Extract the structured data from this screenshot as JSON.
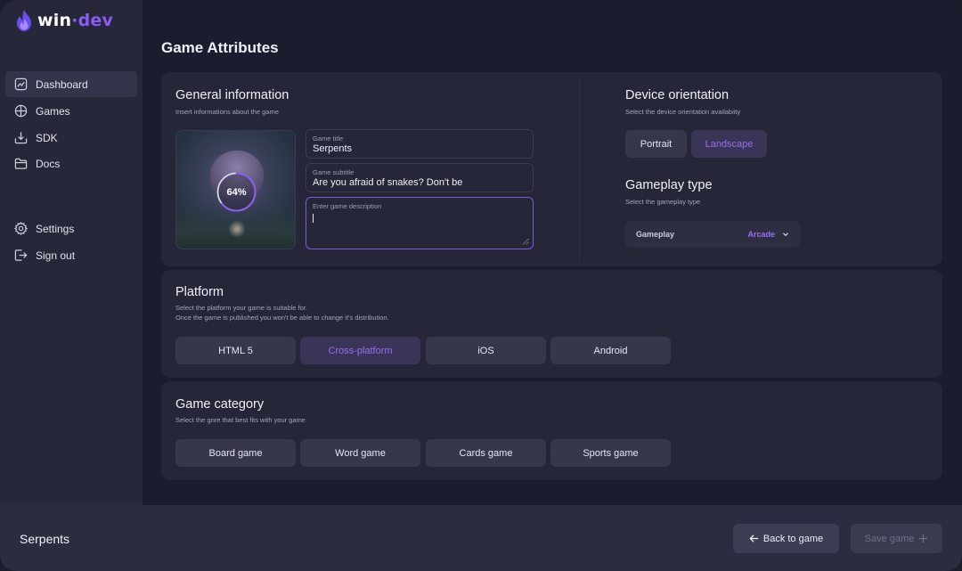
{
  "brand": {
    "name_left": "win",
    "separator": "·",
    "name_right": "dev",
    "accent": "#8a5cf6"
  },
  "sidebar": {
    "items": [
      {
        "label": "Dashboard",
        "icon": "chart-icon",
        "active": true
      },
      {
        "label": "Games",
        "icon": "games-icon"
      },
      {
        "label": "SDK",
        "icon": "download-icon"
      },
      {
        "label": "Docs",
        "icon": "folder-icon"
      },
      {
        "label": "Settings",
        "icon": "gear-icon"
      },
      {
        "label": "Sign out",
        "icon": "sign-out-icon"
      }
    ]
  },
  "page": {
    "title": "Game Attributes"
  },
  "general": {
    "title": "General information",
    "subtitle": "Insert informations about the game",
    "upload_progress": "64%",
    "upload_progress_value": 0.64,
    "fields": {
      "title": {
        "label": "Game title",
        "value": "Serpents"
      },
      "subtitle": {
        "label": "Game subtitle",
        "value": "Are you afraid of snakes? Don't be"
      },
      "description": {
        "label": "Enter game description",
        "value": ""
      }
    }
  },
  "orientation": {
    "title": "Device orientation",
    "subtitle": "Select the device orientation availabiity",
    "options": [
      {
        "label": "Portrait",
        "selected": false
      },
      {
        "label": "Landscape",
        "selected": true
      }
    ]
  },
  "gameplay": {
    "title": "Gameplay type",
    "subtitle": "Select the gameplay type",
    "select_label": "Gameplay",
    "select_value": "Arcade"
  },
  "platform": {
    "title": "Platform",
    "subtitle_1": "Select the platform your game is suitable for.",
    "subtitle_2": "Once the game is published you won't be able to change it's distribution.",
    "options": [
      {
        "label": "HTML 5",
        "selected": false
      },
      {
        "label": "Cross-platform",
        "selected": true
      },
      {
        "label": "iOS",
        "selected": false
      },
      {
        "label": "Android",
        "selected": false
      }
    ]
  },
  "category": {
    "title": "Game category",
    "subtitle": "Select the gnre that best fits with your game",
    "options": [
      {
        "label": "Board game"
      },
      {
        "label": "Word game"
      },
      {
        "label": "Cards game"
      },
      {
        "label": "Sports game"
      }
    ]
  },
  "footer": {
    "game_name": "Serpents",
    "back_label": "Back  to game",
    "save_label": "Save game"
  }
}
